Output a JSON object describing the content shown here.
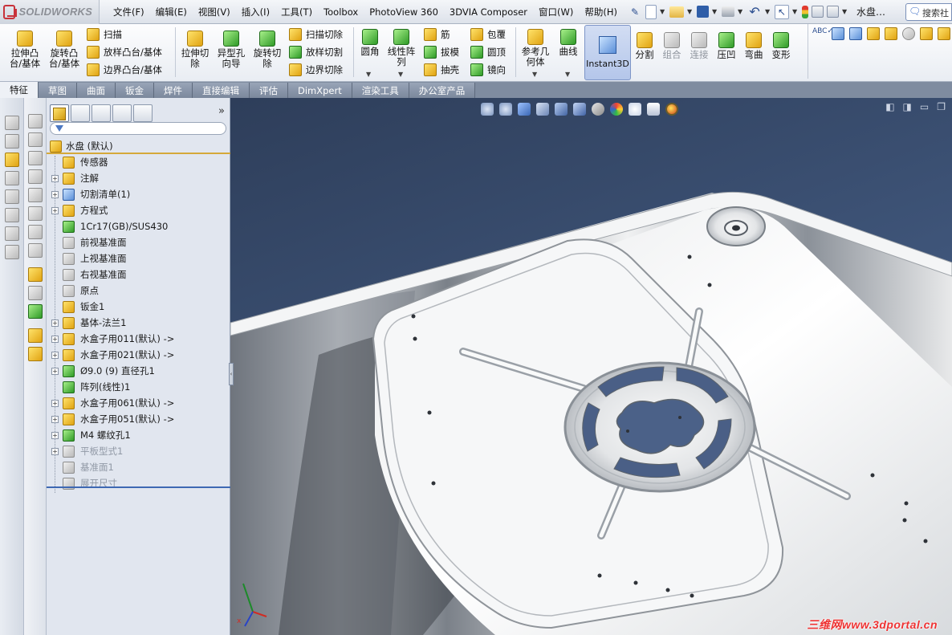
{
  "app": {
    "name": "SOLIDWORKS",
    "doc_title": "水盘…",
    "search_label": "搜索社"
  },
  "menu": [
    "文件(F)",
    "编辑(E)",
    "视图(V)",
    "插入(I)",
    "工具(T)",
    "Toolbox",
    "PhotoView 360",
    "3DVIA Composer",
    "窗口(W)",
    "帮助(H)"
  ],
  "quick_access": [
    "pin-icon",
    "new-document-icon",
    "open-icon",
    "save-icon",
    "print-icon",
    "undo-icon",
    "select-pointer-icon",
    "traffic-light-icon",
    "file-properties-icon",
    "options-icon"
  ],
  "ribbon": {
    "extrude_boss": "拉伸凸\n台/基体",
    "revolve_boss": "旋转凸\n台/基体",
    "sweep": "扫描",
    "loft_boss": "放样凸台/基体",
    "boundary_boss": "边界凸台/基体",
    "extrude_cut": "拉伸切\n除",
    "hole_wizard": "异型孔\n向导",
    "revolve_cut": "旋转切\n除",
    "swept_cut": "扫描切除",
    "lofted_cut": "放样切割",
    "boundary_cut": "边界切除",
    "fillet": "圆角",
    "linear_pattern": "线性阵\n列",
    "rib": "筋",
    "draft": "拔模",
    "shell": "抽壳",
    "wrap": "包覆",
    "dome": "圆顶",
    "mirror": "镜向",
    "ref_geometry": "参考几\n何体",
    "curves": "曲线",
    "instant3d": "Instant3D",
    "split": "分割",
    "combine": "组合",
    "join": "连接",
    "indent": "压凹",
    "flex": "弯曲",
    "deform": "变形"
  },
  "tabs": [
    {
      "label": "特征",
      "active": true
    },
    {
      "label": "草图"
    },
    {
      "label": "曲面"
    },
    {
      "label": "钣金"
    },
    {
      "label": "焊件"
    },
    {
      "label": "直接编辑"
    },
    {
      "label": "评估"
    },
    {
      "label": "DimXpert"
    },
    {
      "label": "渲染工具"
    },
    {
      "label": "办公室产品"
    }
  ],
  "feature_tree": {
    "root": "水盘  (默认)",
    "items": [
      {
        "label": "传感器",
        "expandable": false,
        "icon": "sensor-icon",
        "suppressed": false
      },
      {
        "label": "注解",
        "expandable": true,
        "icon": "annotations-icon",
        "suppressed": false
      },
      {
        "label": "切割清单(1)",
        "expandable": true,
        "icon": "cut-list-icon",
        "suppressed": false
      },
      {
        "label": "方程式",
        "expandable": true,
        "icon": "equations-icon",
        "suppressed": false
      },
      {
        "label": "1Cr17(GB)/SUS430",
        "expandable": false,
        "icon": "material-icon",
        "suppressed": false
      },
      {
        "label": "前视基准面",
        "expandable": false,
        "icon": "plane-icon",
        "suppressed": false
      },
      {
        "label": "上视基准面",
        "expandable": false,
        "icon": "plane-icon",
        "suppressed": false
      },
      {
        "label": "右视基准面",
        "expandable": false,
        "icon": "plane-icon",
        "suppressed": false
      },
      {
        "label": "原点",
        "expandable": false,
        "icon": "origin-icon",
        "suppressed": false
      },
      {
        "label": "钣金1",
        "expandable": false,
        "icon": "sheet-metal-icon",
        "suppressed": false
      },
      {
        "label": "基体-法兰1",
        "expandable": true,
        "icon": "base-flange-icon",
        "suppressed": false
      },
      {
        "label": "水盒子用011(默认) ->",
        "expandable": true,
        "icon": "forming-tool-icon",
        "suppressed": false
      },
      {
        "label": "水盒子用021(默认) ->",
        "expandable": true,
        "icon": "forming-tool-icon",
        "suppressed": false
      },
      {
        "label": "Ø9.0 (9) 直径孔1",
        "expandable": true,
        "icon": "hole-icon",
        "suppressed": false
      },
      {
        "label": "阵列(线性)1",
        "expandable": false,
        "icon": "linear-pattern-icon",
        "suppressed": false
      },
      {
        "label": "水盒子用061(默认) ->",
        "expandable": true,
        "icon": "forming-tool-icon",
        "suppressed": false
      },
      {
        "label": "水盒子用051(默认) ->",
        "expandable": true,
        "icon": "forming-tool-icon",
        "suppressed": false
      },
      {
        "label": "M4 螺纹孔1",
        "expandable": true,
        "icon": "hole-icon",
        "suppressed": false
      },
      {
        "label": "平板型式1",
        "expandable": true,
        "icon": "flat-pattern-icon",
        "suppressed": true
      },
      {
        "label": "基准面1",
        "expandable": false,
        "icon": "plane-icon",
        "suppressed": true
      },
      {
        "label": "展开尺寸",
        "expandable": false,
        "icon": "flat-dimension-icon",
        "suppressed": true
      }
    ]
  },
  "watermark": "三维网www.3dportal.cn",
  "colors": {
    "accent": "#3e68b3",
    "viewport_top": "#2e3e5a",
    "viewport_bottom": "#556d93",
    "instant3d_active": "#b4c6ea"
  }
}
